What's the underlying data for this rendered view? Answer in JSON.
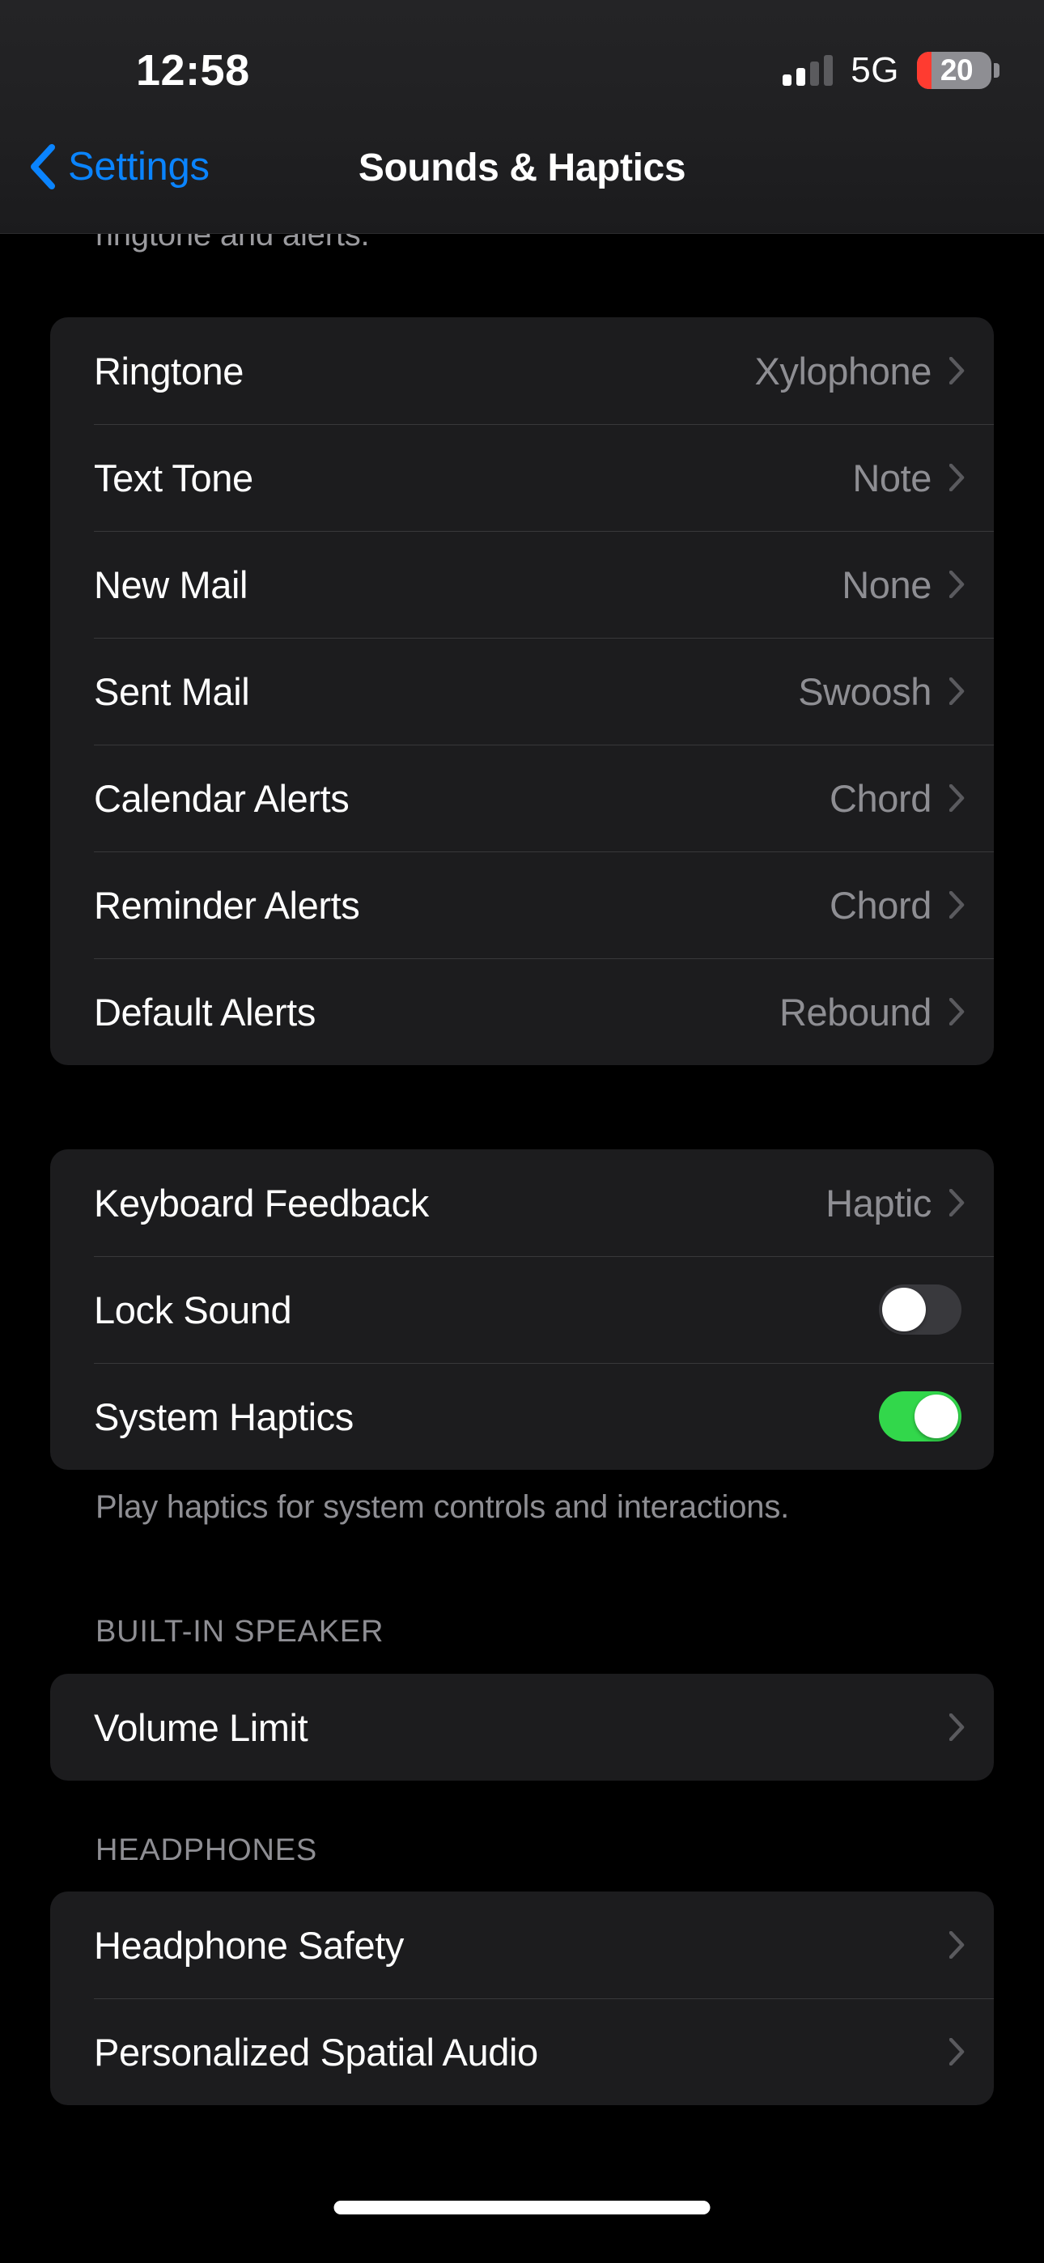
{
  "status_bar": {
    "time": "12:58",
    "network": "5G",
    "battery_percent": "20",
    "battery_level": 20,
    "signal_bars_filled": 2,
    "signal_bars_total": 4,
    "battery_color": "#ff3b30"
  },
  "nav": {
    "back_label": "Settings",
    "title": "Sounds & Haptics",
    "accent_color": "#0a84ff"
  },
  "clipped_footer_text": "ringtone and alerts.",
  "sounds_group": {
    "rows": [
      {
        "label": "Ringtone",
        "value": "Xylophone"
      },
      {
        "label": "Text Tone",
        "value": "Note"
      },
      {
        "label": "New Mail",
        "value": "None"
      },
      {
        "label": "Sent Mail",
        "value": "Swoosh"
      },
      {
        "label": "Calendar Alerts",
        "value": "Chord"
      },
      {
        "label": "Reminder Alerts",
        "value": "Chord"
      },
      {
        "label": "Default Alerts",
        "value": "Rebound"
      }
    ]
  },
  "haptics_group": {
    "keyboard_feedback": {
      "label": "Keyboard Feedback",
      "value": "Haptic"
    },
    "lock_sound": {
      "label": "Lock Sound",
      "state": "off"
    },
    "system_haptics": {
      "label": "System Haptics",
      "state": "on"
    },
    "footnote": "Play haptics for system controls and interactions.",
    "toggle_on_color": "#32d74b",
    "toggle_off_color": "#39393d"
  },
  "speaker_section": {
    "header": "BUILT-IN SPEAKER",
    "rows": [
      {
        "label": "Volume Limit"
      }
    ]
  },
  "headphones_section": {
    "header": "HEADPHONES",
    "rows": [
      {
        "label": "Headphone Safety"
      },
      {
        "label": "Personalized Spatial Audio"
      }
    ]
  },
  "icons": {
    "back_chevron": "chevron-left-icon",
    "disclosure": "chevron-right-icon",
    "home_indicator": "home-indicator"
  }
}
